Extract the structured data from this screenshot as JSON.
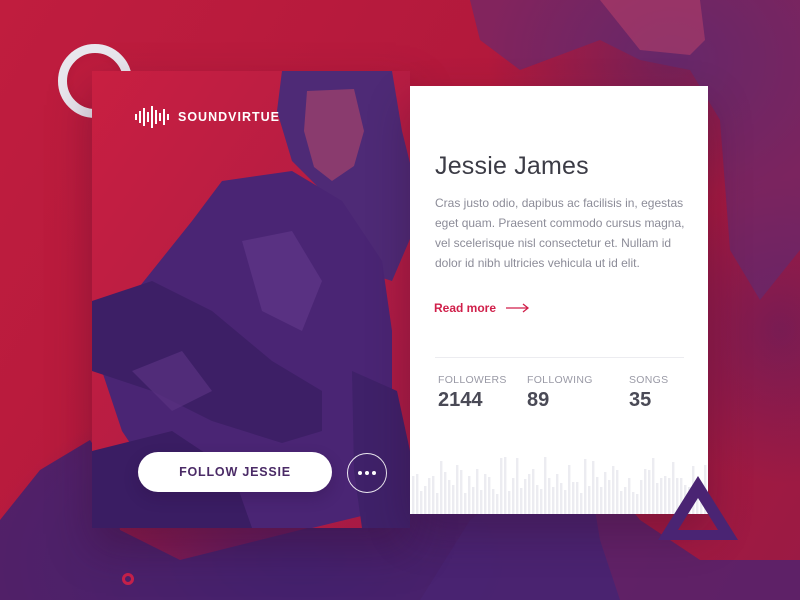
{
  "brand": {
    "name": "SOUNDVIRTUE",
    "logo_icon": "sound-wave-icon"
  },
  "artist": {
    "name": "Jessie James",
    "bio": "Cras justo odio, dapibus ac facilisis in, egestas eget quam. Praesent commodo cursus magna, vel scelerisque nisl consectetur et. Nullam id dolor id nibh ultricies vehicula ut id elit.",
    "read_more_label": "Read more"
  },
  "stats": [
    {
      "label": "FOLLOWERS",
      "value": "2144"
    },
    {
      "label": "FOLLOWING",
      "value": "89"
    },
    {
      "label": "SONGS",
      "value": "35"
    }
  ],
  "actions": {
    "follow_label": "FOLLOW JESSIE",
    "more_icon": "more-dots-icon"
  },
  "colors": {
    "background": "#b3193a",
    "accent": "#d01f4a",
    "deep_purple": "#4a2a66",
    "card": "#ffffff"
  }
}
